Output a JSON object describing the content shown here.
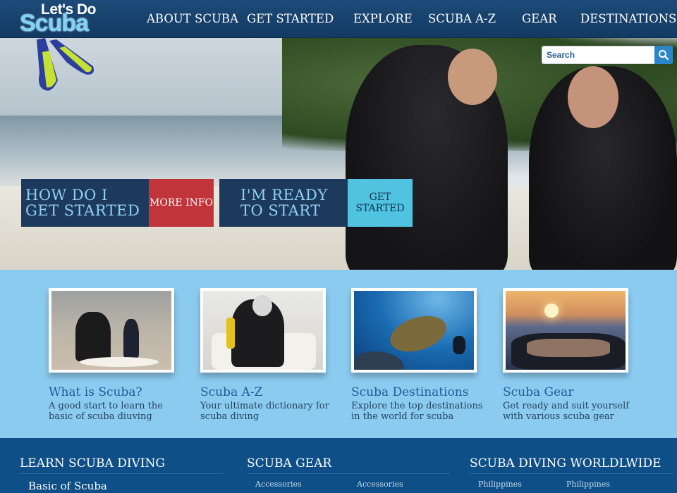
{
  "header": {
    "logo_line1": "Let's Do",
    "logo_line2": "Scuba",
    "nav": [
      "ABOUT SCUBA",
      "GET STARTED",
      "EXPLORE",
      "SCUBA A-Z",
      "GEAR",
      "DESTINATIONS"
    ]
  },
  "search": {
    "placeholder": "Search"
  },
  "hero": {
    "cta1_big": "HOW DO I GET STARTED",
    "cta1_small": "MORE INFO",
    "cta2_big": "I'M READY TO START",
    "cta2_small": "GET STARTED"
  },
  "features": [
    {
      "title": "What is Scuba?",
      "desc": "A good start to learn the basic of scuba diuving"
    },
    {
      "title": "Scuba A-Z",
      "desc": "Your ultimate dictionary for scuba diving"
    },
    {
      "title": "Scuba Destinations",
      "desc": "Explore the top destinations in the world for scuba"
    },
    {
      "title": "Scuba Gear",
      "desc": "Get ready and suit yourself with various scuba gear"
    }
  ],
  "footer": {
    "col1": {
      "heading": "LEARN SCUBA DIVING",
      "sub": "Basic of Scuba"
    },
    "col2": {
      "heading": "SCUBA GEAR",
      "links": [
        "Accessories",
        "Accessories"
      ]
    },
    "col3": {
      "heading": "SCUBA DIVING WORLDLWIDE",
      "links": [
        "Philippines",
        "Philippines"
      ]
    }
  },
  "colors": {
    "header": "#133a63",
    "band": "#8ccbf0",
    "cta_dark": "#1d3a5d",
    "cta_red": "#c0343a",
    "cta_teal": "#4fc3e0",
    "footer": "#0e4f87"
  }
}
